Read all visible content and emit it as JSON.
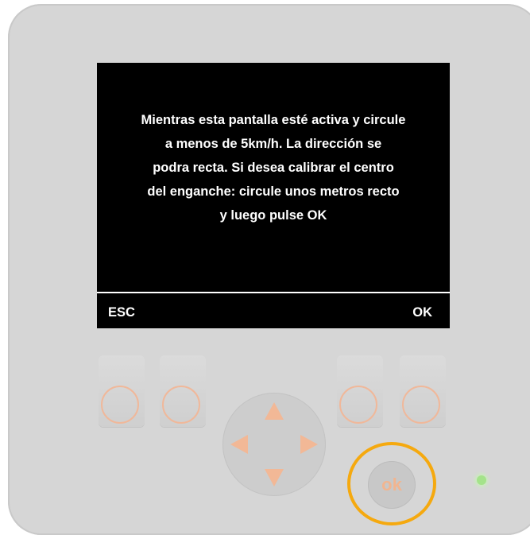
{
  "screen": {
    "message": "Mientras esta pantalla esté activa y circule\na menos de 5km/h. La dirección se\npodra recta. Si desea calibrar el centro\ndel enganche: circule unos metros recto\ny luego pulse OK",
    "softkey_left": "ESC",
    "softkey_right": "OK"
  },
  "controls": {
    "ok_button_label": "ok",
    "softkeys": [
      "softkey-1",
      "softkey-2",
      "softkey-3",
      "softkey-4"
    ],
    "dpad_arrows": [
      "up",
      "down",
      "left",
      "right"
    ]
  },
  "colors": {
    "device_body": "#d6d6d6",
    "screen_bg": "#000000",
    "screen_text": "#ffffff",
    "button_accent": "#f2b896",
    "highlight_ring": "#f5a90f",
    "status_led": "#a4e38a"
  }
}
